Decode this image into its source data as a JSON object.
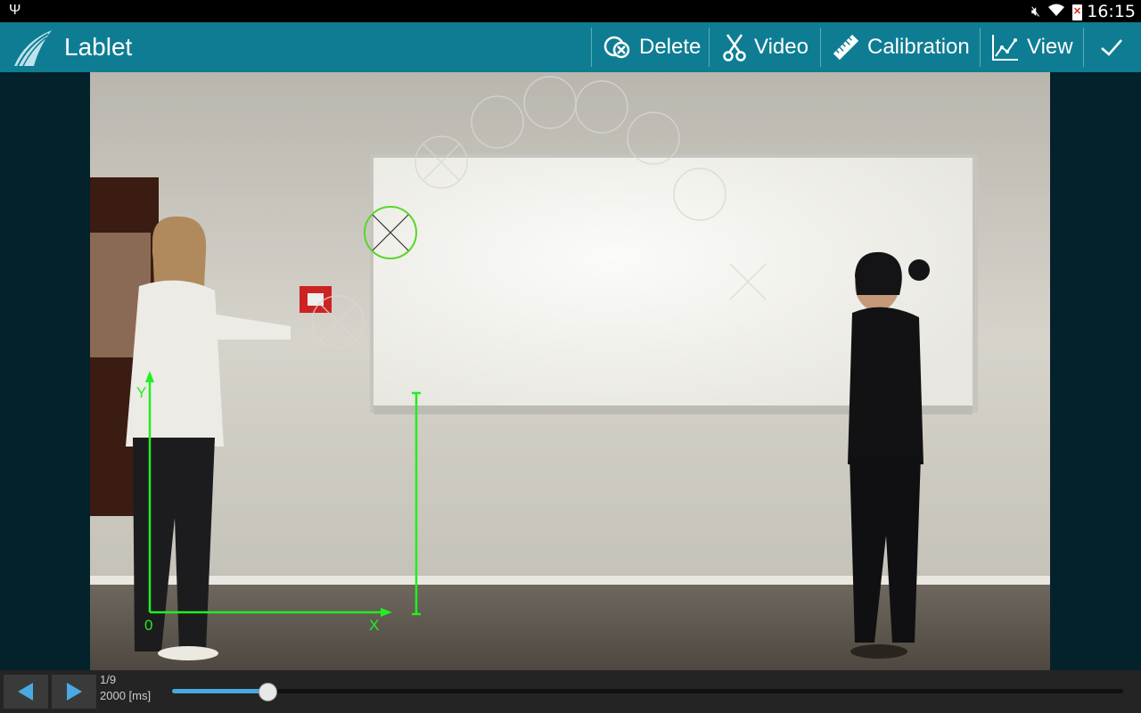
{
  "status_bar": {
    "time": "16:15"
  },
  "app": {
    "title": "Lablet"
  },
  "toolbar": {
    "delete_label": "Delete",
    "video_label": "Video",
    "calibration_label": "Calibration",
    "view_label": "View"
  },
  "video": {
    "axis_y_label": "Y",
    "axis_x_label": "X",
    "origin_label": "0"
  },
  "playback": {
    "frame_index": "1/9",
    "frame_time": "2000 [ms]",
    "progress": 0.1
  },
  "colors": {
    "action_bar": "#0e7d93",
    "marker_green": "#22ee22",
    "seek_fill": "#4aa9e0"
  }
}
